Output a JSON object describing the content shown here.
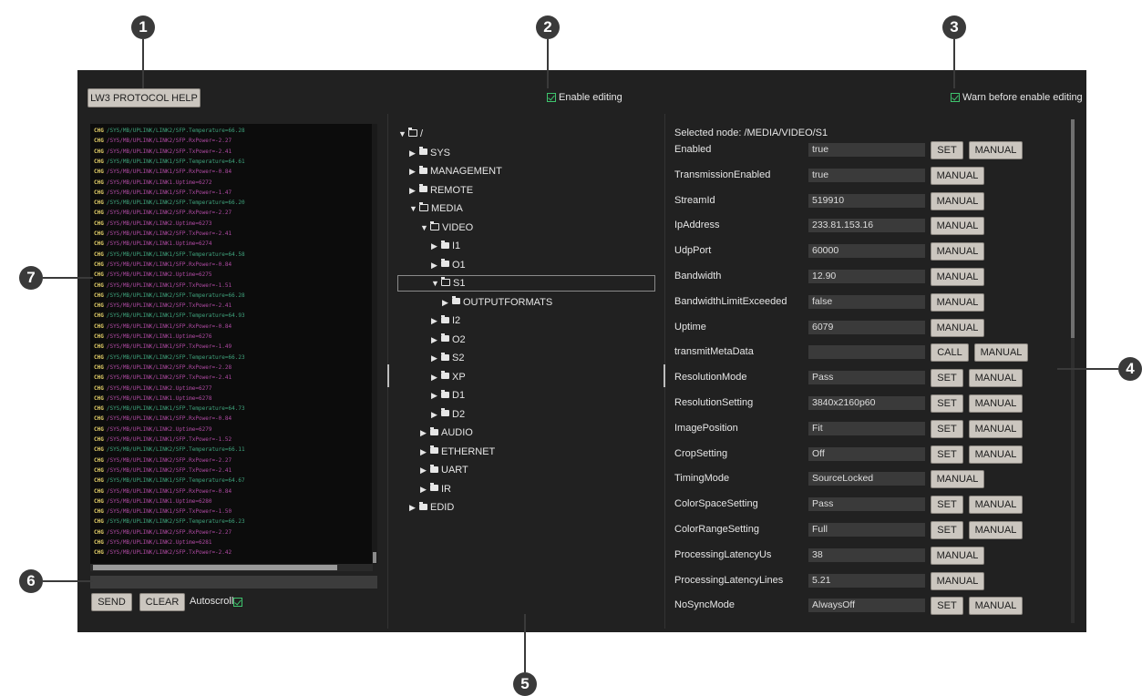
{
  "header": {
    "help_button": "LW3 PROTOCOL HELP",
    "enable_editing_label": "Enable editing",
    "warn_label": "Warn before enable editing"
  },
  "console": {
    "lines": [
      {
        "path": "/SYS/MB/UPLINK/LINK2/SFP.Temperature=66.28",
        "color": "#3fa37c"
      },
      {
        "path": "/SYS/MB/UPLINK/LINK2/SFP.RxPower=-2.27",
        "color": "#b04aa3"
      },
      {
        "path": "/SYS/MB/UPLINK/LINK2/SFP.TxPower=-2.41",
        "color": "#b04aa3"
      },
      {
        "path": "/SYS/MB/UPLINK/LINK1/SFP.Temperature=64.61",
        "color": "#3fa37c"
      },
      {
        "path": "/SYS/MB/UPLINK/LINK1/SFP.RxPower=-0.84",
        "color": "#b04aa3"
      },
      {
        "path": "/SYS/MB/UPLINK/LINK1.Uptime=6272",
        "color": "#b04aa3"
      },
      {
        "path": "/SYS/MB/UPLINK/LINK1/SFP.TxPower=-1.47",
        "color": "#b04aa3"
      },
      {
        "path": "/SYS/MB/UPLINK/LINK2/SFP.Temperature=66.20",
        "color": "#3fa37c"
      },
      {
        "path": "/SYS/MB/UPLINK/LINK2/SFP.RxPower=-2.27",
        "color": "#b04aa3"
      },
      {
        "path": "/SYS/MB/UPLINK/LINK2.Uptime=6273",
        "color": "#b04aa3"
      },
      {
        "path": "/SYS/MB/UPLINK/LINK2/SFP.TxPower=-2.41",
        "color": "#b04aa3"
      },
      {
        "path": "/SYS/MB/UPLINK/LINK1.Uptime=6274",
        "color": "#b04aa3"
      },
      {
        "path": "/SYS/MB/UPLINK/LINK1/SFP.Temperature=64.58",
        "color": "#3fa37c"
      },
      {
        "path": "/SYS/MB/UPLINK/LINK1/SFP.RxPower=-0.84",
        "color": "#b04aa3"
      },
      {
        "path": "/SYS/MB/UPLINK/LINK2.Uptime=6275",
        "color": "#b04aa3"
      },
      {
        "path": "/SYS/MB/UPLINK/LINK1/SFP.TxPower=-1.51",
        "color": "#b04aa3"
      },
      {
        "path": "/SYS/MB/UPLINK/LINK2/SFP.Temperature=66.28",
        "color": "#3fa37c"
      },
      {
        "path": "/SYS/MB/UPLINK/LINK2/SFP.TxPower=-2.41",
        "color": "#b04aa3"
      },
      {
        "path": "/SYS/MB/UPLINK/LINK1/SFP.Temperature=64.93",
        "color": "#3fa37c"
      },
      {
        "path": "/SYS/MB/UPLINK/LINK1/SFP.RxPower=-0.84",
        "color": "#b04aa3"
      },
      {
        "path": "/SYS/MB/UPLINK/LINK1.Uptime=6276",
        "color": "#b04aa3"
      },
      {
        "path": "/SYS/MB/UPLINK/LINK1/SFP.TxPower=-1.49",
        "color": "#b04aa3"
      },
      {
        "path": "/SYS/MB/UPLINK/LINK2/SFP.Temperature=66.23",
        "color": "#3fa37c"
      },
      {
        "path": "/SYS/MB/UPLINK/LINK2/SFP.RxPower=-2.28",
        "color": "#b04aa3"
      },
      {
        "path": "/SYS/MB/UPLINK/LINK2/SFP.TxPower=-2.41",
        "color": "#b04aa3"
      },
      {
        "path": "/SYS/MB/UPLINK/LINK2.Uptime=6277",
        "color": "#b04aa3"
      },
      {
        "path": "/SYS/MB/UPLINK/LINK1.Uptime=6278",
        "color": "#b04aa3"
      },
      {
        "path": "/SYS/MB/UPLINK/LINK1/SFP.Temperature=64.73",
        "color": "#3fa37c"
      },
      {
        "path": "/SYS/MB/UPLINK/LINK1/SFP.RxPower=-0.84",
        "color": "#b04aa3"
      },
      {
        "path": "/SYS/MB/UPLINK/LINK2.Uptime=6279",
        "color": "#b04aa3"
      },
      {
        "path": "/SYS/MB/UPLINK/LINK1/SFP.TxPower=-1.52",
        "color": "#b04aa3"
      },
      {
        "path": "/SYS/MB/UPLINK/LINK2/SFP.Temperature=66.11",
        "color": "#3fa37c"
      },
      {
        "path": "/SYS/MB/UPLINK/LINK2/SFP.RxPower=-2.27",
        "color": "#b04aa3"
      },
      {
        "path": "/SYS/MB/UPLINK/LINK2/SFP.TxPower=-2.41",
        "color": "#b04aa3"
      },
      {
        "path": "/SYS/MB/UPLINK/LINK1/SFP.Temperature=64.67",
        "color": "#3fa37c"
      },
      {
        "path": "/SYS/MB/UPLINK/LINK1/SFP.RxPower=-0.84",
        "color": "#b04aa3"
      },
      {
        "path": "/SYS/MB/UPLINK/LINK1.Uptime=6280",
        "color": "#b04aa3"
      },
      {
        "path": "/SYS/MB/UPLINK/LINK1/SFP.TxPower=-1.50",
        "color": "#b04aa3"
      },
      {
        "path": "/SYS/MB/UPLINK/LINK2/SFP.Temperature=66.23",
        "color": "#3fa37c"
      },
      {
        "path": "/SYS/MB/UPLINK/LINK2/SFP.RxPower=-2.27",
        "color": "#b04aa3"
      },
      {
        "path": "/SYS/MB/UPLINK/LINK2.Uptime=6281",
        "color": "#b04aa3"
      },
      {
        "path": "/SYS/MB/UPLINK/LINK2/SFP.TxPower=-2.42",
        "color": "#b04aa3"
      }
    ],
    "tag": "CHG",
    "send_button": "SEND",
    "clear_button": "CLEAR",
    "autoscroll_label": "Autoscroll"
  },
  "tree": {
    "items": [
      {
        "label": "/",
        "indent": 0,
        "open": true
      },
      {
        "label": "SYS",
        "indent": 1,
        "open": false
      },
      {
        "label": "MANAGEMENT",
        "indent": 1,
        "open": false
      },
      {
        "label": "REMOTE",
        "indent": 1,
        "open": false
      },
      {
        "label": "MEDIA",
        "indent": 1,
        "open": true
      },
      {
        "label": "VIDEO",
        "indent": 2,
        "open": true
      },
      {
        "label": "I1",
        "indent": 3,
        "open": false
      },
      {
        "label": "O1",
        "indent": 3,
        "open": false
      },
      {
        "label": "S1",
        "indent": 3,
        "open": true,
        "selected": true
      },
      {
        "label": "OUTPUTFORMATS",
        "indent": 4,
        "open": false
      },
      {
        "label": "I2",
        "indent": 3,
        "open": false
      },
      {
        "label": "O2",
        "indent": 3,
        "open": false
      },
      {
        "label": "S2",
        "indent": 3,
        "open": false
      },
      {
        "label": "XP",
        "indent": 3,
        "open": false
      },
      {
        "label": "D1",
        "indent": 3,
        "open": false
      },
      {
        "label": "D2",
        "indent": 3,
        "open": false
      },
      {
        "label": "AUDIO",
        "indent": 2,
        "open": false
      },
      {
        "label": "ETHERNET",
        "indent": 2,
        "open": false
      },
      {
        "label": "UART",
        "indent": 2,
        "open": false
      },
      {
        "label": "IR",
        "indent": 2,
        "open": false
      },
      {
        "label": "EDID",
        "indent": 1,
        "open": false
      }
    ]
  },
  "properties": {
    "selected_node": "Selected node: /MEDIA/VIDEO/S1",
    "rows": [
      {
        "name": "Enabled",
        "value": "true",
        "buttons": [
          "SET",
          "MANUAL"
        ]
      },
      {
        "name": "TransmissionEnabled",
        "value": "true",
        "buttons": [
          "MANUAL"
        ]
      },
      {
        "name": "StreamId",
        "value": "519910",
        "buttons": [
          "MANUAL"
        ]
      },
      {
        "name": "IpAddress",
        "value": "233.81.153.16",
        "buttons": [
          "MANUAL"
        ]
      },
      {
        "name": "UdpPort",
        "value": "60000",
        "buttons": [
          "MANUAL"
        ]
      },
      {
        "name": "Bandwidth",
        "value": "12.90",
        "buttons": [
          "MANUAL"
        ]
      },
      {
        "name": "BandwidthLimitExceeded",
        "value": "false",
        "buttons": [
          "MANUAL"
        ]
      },
      {
        "name": "Uptime",
        "value": "6079",
        "buttons": [
          "MANUAL"
        ]
      },
      {
        "name": "transmitMetaData",
        "value": "",
        "buttons": [
          "CALL",
          "MANUAL"
        ]
      },
      {
        "name": "ResolutionMode",
        "value": "Pass",
        "buttons": [
          "SET",
          "MANUAL"
        ]
      },
      {
        "name": "ResolutionSetting",
        "value": "3840x2160p60",
        "buttons": [
          "SET",
          "MANUAL"
        ]
      },
      {
        "name": "ImagePosition",
        "value": "Fit",
        "buttons": [
          "SET",
          "MANUAL"
        ]
      },
      {
        "name": "CropSetting",
        "value": "Off",
        "buttons": [
          "SET",
          "MANUAL"
        ]
      },
      {
        "name": "TimingMode",
        "value": "SourceLocked",
        "buttons": [
          "MANUAL"
        ]
      },
      {
        "name": "ColorSpaceSetting",
        "value": "Pass",
        "buttons": [
          "SET",
          "MANUAL"
        ]
      },
      {
        "name": "ColorRangeSetting",
        "value": "Full",
        "buttons": [
          "SET",
          "MANUAL"
        ]
      },
      {
        "name": "ProcessingLatencyUs",
        "value": "38",
        "buttons": [
          "MANUAL"
        ]
      },
      {
        "name": "ProcessingLatencyLines",
        "value": "5.21",
        "buttons": [
          "MANUAL"
        ]
      },
      {
        "name": "NoSyncMode",
        "value": "AlwaysOff",
        "buttons": [
          "SET",
          "MANUAL"
        ]
      }
    ]
  },
  "callouts": [
    "1",
    "2",
    "3",
    "4",
    "5",
    "6",
    "7"
  ],
  "colors": {
    "panel_bg": "#212121",
    "console_bg": "#0c0c0c",
    "button_bg": "#cbc6bf",
    "check_green": "#3ec46d",
    "callout_bg": "#3a3a3a"
  }
}
